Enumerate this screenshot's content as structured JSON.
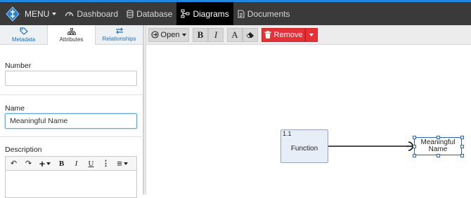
{
  "nav": {
    "logo_icon": "diamond-logo-icon",
    "menu_label": "MENU",
    "items": [
      {
        "label": "Dashboard",
        "icon": "dashboard-icon",
        "active": false
      },
      {
        "label": "Database",
        "icon": "database-icon",
        "active": false
      },
      {
        "label": "Diagrams",
        "icon": "diagram-icon",
        "active": true
      },
      {
        "label": "Documents",
        "icon": "document-icon",
        "active": false
      }
    ],
    "accent": "#1e88e5",
    "bg": "#3a3a3a"
  },
  "left_panel": {
    "tabs": [
      {
        "label": "Metadata",
        "icon": "tag-icon",
        "active": false
      },
      {
        "label": "Attributes",
        "icon": "sitemap-icon",
        "active": true
      },
      {
        "label": "Relationships",
        "icon": "exchange-icon",
        "active": false
      }
    ],
    "fields": {
      "number": {
        "label": "Number",
        "value": ""
      },
      "name": {
        "label": "Name",
        "value": "Meaningful Name"
      },
      "description": {
        "label": "Description",
        "value": ""
      }
    },
    "rte_toolbar": [
      {
        "name": "undo-icon",
        "glyph": "↶"
      },
      {
        "name": "redo-icon",
        "glyph": "↷"
      },
      {
        "name": "insert-icon",
        "glyph": "+"
      },
      {
        "name": "bold-icon",
        "glyph": "B"
      },
      {
        "name": "italic-icon",
        "glyph": "I"
      },
      {
        "name": "underline-icon",
        "glyph": "U"
      },
      {
        "name": "more-icon",
        "glyph": "⋮"
      },
      {
        "name": "align-icon",
        "glyph": "≡"
      }
    ]
  },
  "canvas_toolbar": {
    "open_label": "Open",
    "bold": "B",
    "italic": "I",
    "font": "A",
    "eraser_icon": "eraser-icon",
    "remove_label": "Remove",
    "remove_color": "#e53035"
  },
  "diagram": {
    "nodes": [
      {
        "number": "1.1",
        "label": "Function"
      },
      {
        "label_line1": "Meaningful",
        "label_line2": "Name"
      }
    ]
  }
}
